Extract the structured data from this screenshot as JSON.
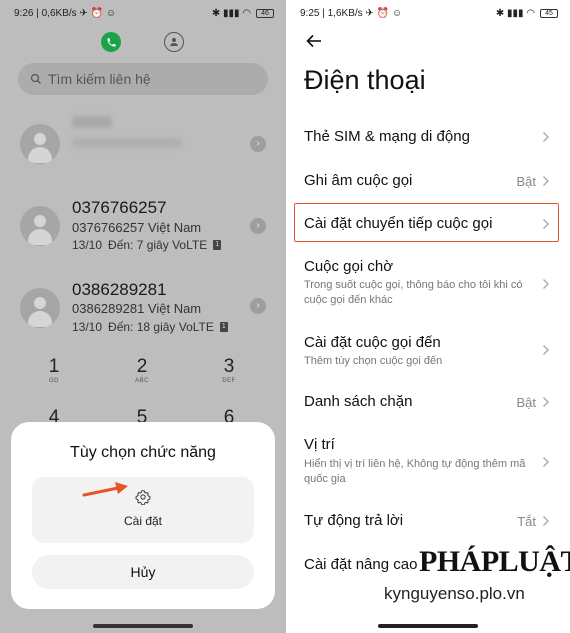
{
  "left": {
    "status": {
      "time": "9:26",
      "speed": "0,6KB/s",
      "battery": "46"
    },
    "search": {
      "placeholder": "Tìm kiếm liên hệ"
    },
    "calls": [
      {
        "number": "",
        "subtitle": "",
        "date": "",
        "detail": ""
      },
      {
        "number": "0376766257",
        "subtitle": "0376766257  Việt Nam",
        "date": "13/10",
        "detail": "Đến: 7 giây VoLTE",
        "sim": "1"
      },
      {
        "number": "0386289281",
        "subtitle": "0386289281  Việt Nam",
        "date": "13/10",
        "detail": "Đến: 18 giây VoLTE",
        "sim": "1"
      }
    ],
    "keypad": [
      {
        "digit": "1",
        "letters": "GD"
      },
      {
        "digit": "2",
        "letters": "ABC"
      },
      {
        "digit": "3",
        "letters": "DEF"
      },
      {
        "digit": "4",
        "letters": ""
      },
      {
        "digit": "5",
        "letters": ""
      },
      {
        "digit": "6",
        "letters": ""
      }
    ],
    "sheet": {
      "title": "Tùy chọn chức năng",
      "option_label": "Cài đặt",
      "cancel_label": "Hủy"
    }
  },
  "right": {
    "status": {
      "time": "9:25",
      "speed": "1,6KB/s",
      "battery": "45"
    },
    "title": "Điện thoại",
    "rows": [
      {
        "title": "Thẻ SIM & mạng di động",
        "subtitle": "",
        "value": ""
      },
      {
        "title": "Ghi âm cuộc gọi",
        "subtitle": "",
        "value": "Bật"
      },
      {
        "title": "Cài đặt chuyển tiếp cuộc gọi",
        "subtitle": "",
        "value": ""
      },
      {
        "title": "Cuộc gọi chờ",
        "subtitle": "Trong suốt cuộc gọi, thông báo cho tôi khi có cuộc gọi đến khác",
        "value": ""
      },
      {
        "title": "Cài đặt cuộc gọi đến",
        "subtitle": "Thêm tùy chọn cuộc gọi đến",
        "value": ""
      },
      {
        "title": "Danh sách chặn",
        "subtitle": "",
        "value": "Bật"
      },
      {
        "title": "Vị trí",
        "subtitle": "Hiển thị vị trí liên hệ, Không tự động thêm mã quốc gia",
        "value": ""
      },
      {
        "title": "Tự động trả lời",
        "subtitle": "",
        "value": "Tắt"
      },
      {
        "title": "Cài đặt nâng cao",
        "subtitle": "",
        "value": ""
      }
    ]
  },
  "watermark": {
    "logo": "PHÁPLUẬT",
    "site": "kynguyenso.plo.vn"
  },
  "colors": {
    "accent_green": "#1aa34a",
    "highlight_red": "#e4572e",
    "arrow_orange": "#e8542a"
  }
}
